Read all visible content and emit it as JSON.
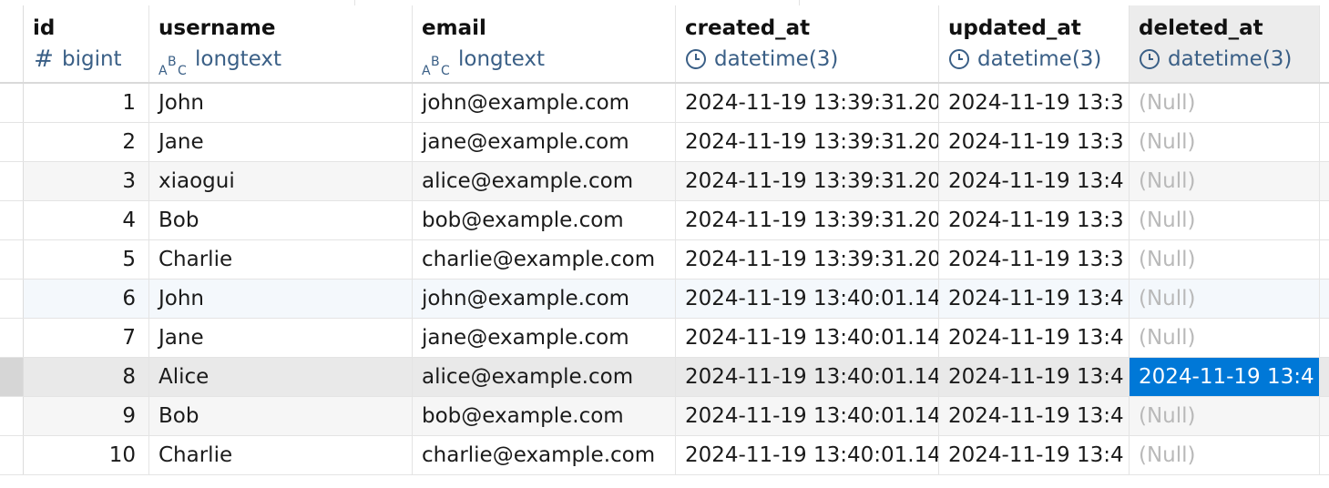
{
  "columns": [
    {
      "name": "id",
      "type": "bigint",
      "type_icon": "hash-icon"
    },
    {
      "name": "username",
      "type": "longtext",
      "type_icon": "text-abc-icon"
    },
    {
      "name": "email",
      "type": "longtext",
      "type_icon": "text-abc-icon"
    },
    {
      "name": "created_at",
      "type": "datetime(3)",
      "type_icon": "clock-icon"
    },
    {
      "name": "updated_at",
      "type": "datetime(3)",
      "type_icon": "clock-icon"
    },
    {
      "name": "deleted_at",
      "type": "datetime(3)",
      "type_icon": "clock-icon"
    }
  ],
  "rows": [
    {
      "id": "1",
      "username": "John",
      "email": "john@example.com",
      "created_at": "2024-11-19 13:39:31.20",
      "updated_at": "2024-11-19 13:3",
      "deleted_at": "(Null)"
    },
    {
      "id": "2",
      "username": "Jane",
      "email": "jane@example.com",
      "created_at": "2024-11-19 13:39:31.20",
      "updated_at": "2024-11-19 13:3",
      "deleted_at": "(Null)"
    },
    {
      "id": "3",
      "username": "xiaogui",
      "email": "alice@example.com",
      "created_at": "2024-11-19 13:39:31.20",
      "updated_at": "2024-11-19 13:4",
      "deleted_at": "(Null)"
    },
    {
      "id": "4",
      "username": "Bob",
      "email": "bob@example.com",
      "created_at": "2024-11-19 13:39:31.20",
      "updated_at": "2024-11-19 13:3",
      "deleted_at": "(Null)"
    },
    {
      "id": "5",
      "username": "Charlie",
      "email": "charlie@example.com",
      "created_at": "2024-11-19 13:39:31.20",
      "updated_at": "2024-11-19 13:3",
      "deleted_at": "(Null)"
    },
    {
      "id": "6",
      "username": "John",
      "email": "john@example.com",
      "created_at": "2024-11-19 13:40:01.14",
      "updated_at": "2024-11-19 13:4",
      "deleted_at": "(Null)"
    },
    {
      "id": "7",
      "username": "Jane",
      "email": "jane@example.com",
      "created_at": "2024-11-19 13:40:01.14",
      "updated_at": "2024-11-19 13:4",
      "deleted_at": "(Null)"
    },
    {
      "id": "8",
      "username": "Alice",
      "email": "alice@example.com",
      "created_at": "2024-11-19 13:40:01.14",
      "updated_at": "2024-11-19 13:4",
      "deleted_at": "2024-11-19 13:4"
    },
    {
      "id": "9",
      "username": "Bob",
      "email": "bob@example.com",
      "created_at": "2024-11-19 13:40:01.14",
      "updated_at": "2024-11-19 13:4",
      "deleted_at": "(Null)"
    },
    {
      "id": "10",
      "username": "Charlie",
      "email": "charlie@example.com",
      "created_at": "2024-11-19 13:40:01.14",
      "updated_at": "2024-11-19 13:4",
      "deleted_at": "(Null)"
    }
  ],
  "state": {
    "selected_row_id": "8",
    "selected_column": "deleted_at",
    "hover_row_id": "6"
  },
  "colors": {
    "selection": "#0078d7",
    "type_text": "#3a5f86",
    "null_text": "#b9b9b9",
    "selected_row": "#e9e9e9"
  }
}
